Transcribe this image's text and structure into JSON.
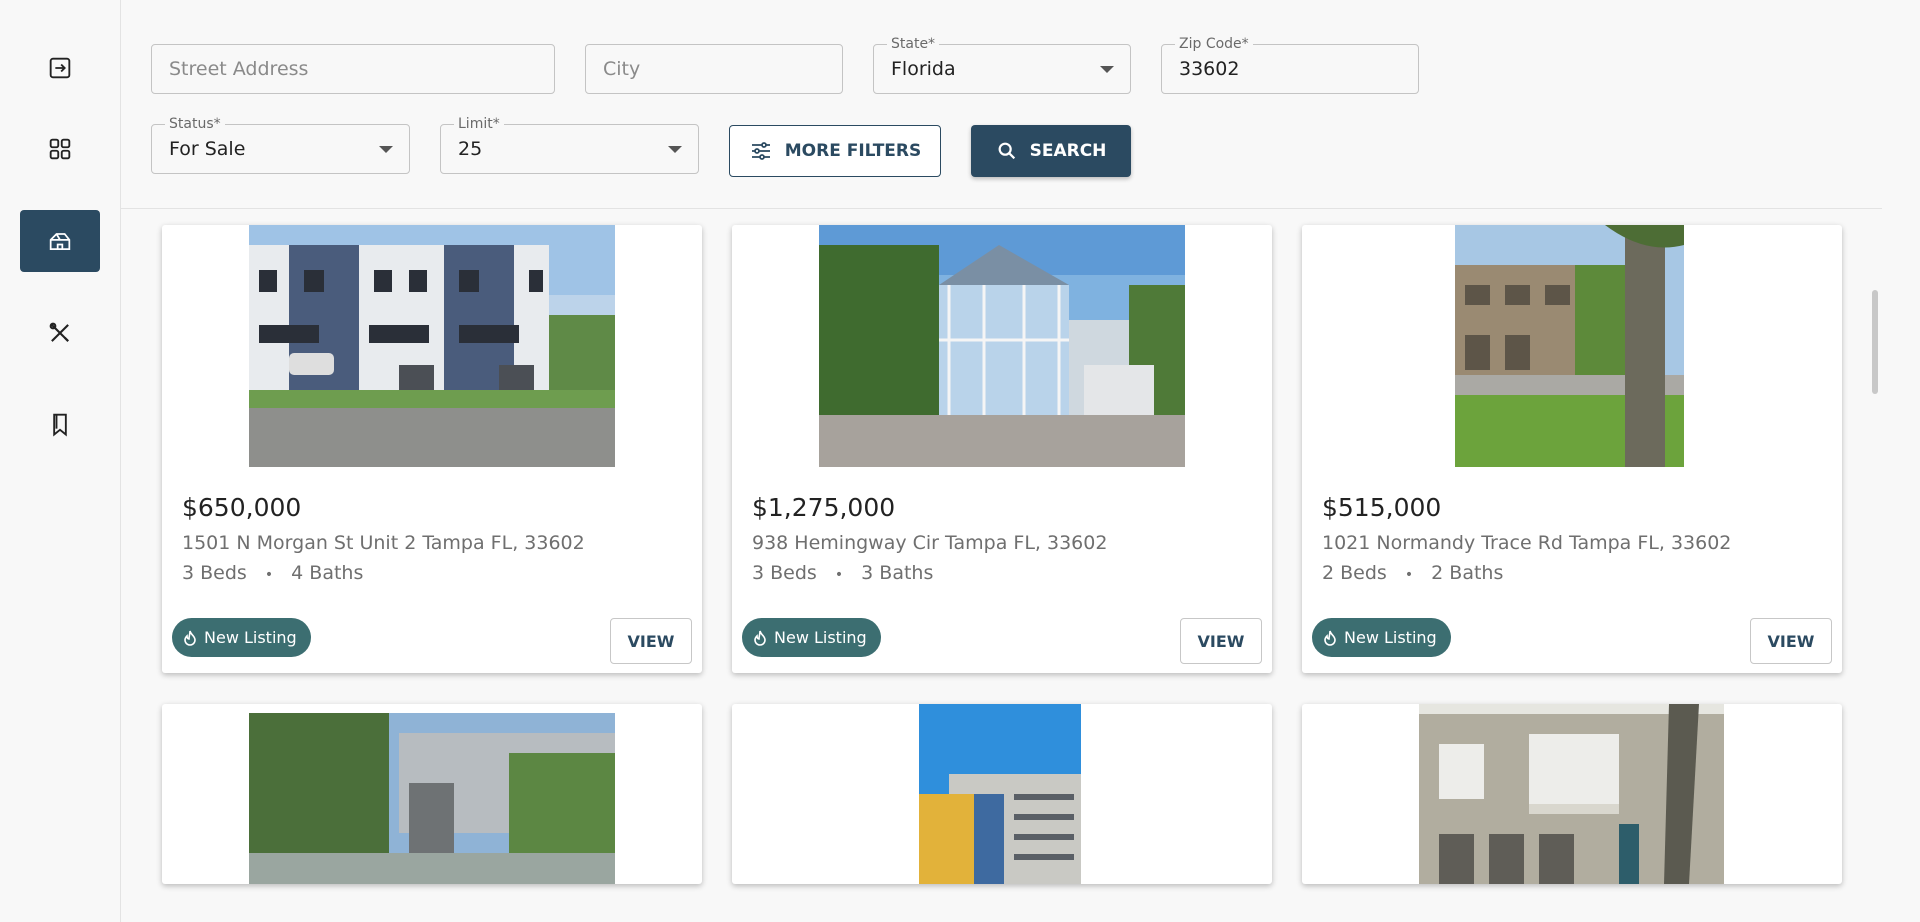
{
  "sidebar": {
    "items": [
      {
        "icon": "login-icon"
      },
      {
        "icon": "dashboard-grid-icon"
      },
      {
        "icon": "home-icon",
        "active": true
      },
      {
        "icon": "tools-icon"
      },
      {
        "icon": "bookmark-icon"
      }
    ]
  },
  "filters": {
    "street_placeholder": "Street Address",
    "city_placeholder": "City",
    "state_label": "State*",
    "state_value": "Florida",
    "zip_label": "Zip Code*",
    "zip_value": "33602",
    "status_label": "Status*",
    "status_value": "For Sale",
    "limit_label": "Limit*",
    "limit_value": "25",
    "more_filters_label": "MORE FILTERS",
    "search_label": "SEARCH"
  },
  "listings": [
    {
      "price": "$650,000",
      "address": "1501 N Morgan St Unit 2 Tampa FL, 33602",
      "beds": "3 Beds",
      "baths": "4 Baths",
      "badge": "New Listing",
      "view_label": "VIEW"
    },
    {
      "price": "$1,275,000",
      "address": "938 Hemingway Cir Tampa FL, 33602",
      "beds": "3 Beds",
      "baths": "3 Baths",
      "badge": "New Listing",
      "view_label": "VIEW"
    },
    {
      "price": "$515,000",
      "address": "1021 Normandy Trace Rd Tampa FL, 33602",
      "beds": "2 Beds",
      "baths": "2 Baths",
      "badge": "New Listing",
      "view_label": "VIEW"
    }
  ],
  "separator": "•",
  "colors": {
    "primary": "#2b4a61",
    "badge": "#3c6e71"
  }
}
